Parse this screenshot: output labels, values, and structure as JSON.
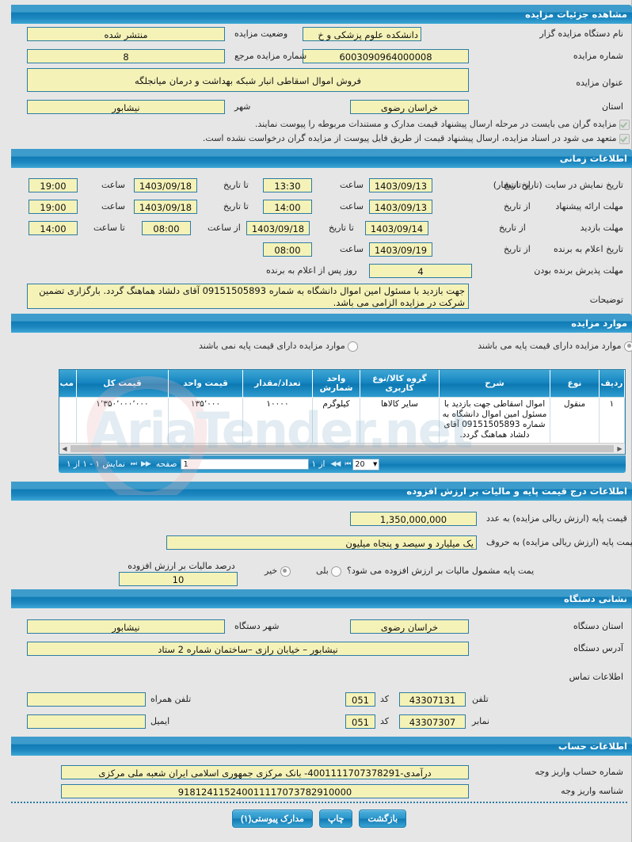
{
  "sections": {
    "details": "مشاهده جزئیات مزایده",
    "timing": "اطلاعات زمانی",
    "items": "موارد مزایده",
    "base_price": "اطلاعات درج قیمت پایه و مالیات بر ارزش افزوده",
    "address": "نشانی دستگاه",
    "account": "اطلاعات حساب"
  },
  "details": {
    "org_label": "نام دستگاه مزایده گزار",
    "org_value": "دانشکده علوم پزشکی و خ",
    "status_label": "وضعیت مزایده",
    "status_value": "منتشر شده",
    "auction_no_label": "شماره مزایده",
    "auction_no_value": "6003090964000008",
    "ref_no_label": "شماره مزایده مرجع",
    "ref_no_value": "8",
    "title_label": "عنوان مزایده",
    "title_value": "فروش اموال اسقاطی انبار شبکه بهداشت و درمان میانجلگه",
    "province_label": "استان",
    "province_value": "خراسان رضوی",
    "city_label": "شهر",
    "city_value": "نیشابور",
    "note1": "مزایده گران می بایست در مرحله ارسال پیشنهاد قیمت مدارک و مستندات مربوطه را پیوست نمایند.",
    "note2": "متعهد می شود در اسناد مزایده، ارسال پیشنهاد قیمت از طریق فایل پیوست از مزایده گران درخواست نشده است."
  },
  "timing": {
    "rows": [
      {
        "label": "تاریخ نمایش در سایت (تاریخ انتشار)",
        "from_label": "از تاریخ",
        "from_value": "1403/09/13",
        "time1_label": "ساعت",
        "time1_value": "13:30",
        "to_label": "تا تاریخ",
        "to_value": "1403/09/18",
        "time2_label": "ساعت",
        "time2_value": "19:00"
      },
      {
        "label": "مهلت ارائه پیشنهاد",
        "from_label": "از تاریخ",
        "from_value": "1403/09/13",
        "time1_label": "ساعت",
        "time1_value": "14:00",
        "to_label": "تا تاریخ",
        "to_value": "1403/09/18",
        "time2_label": "ساعت",
        "time2_value": "19:00"
      },
      {
        "label": "مهلت بازدید",
        "from_label": "از تاریخ",
        "from_value": "1403/09/14",
        "to_label": "تا تاریخ",
        "to_value": "1403/09/18",
        "time1_label": "از ساعت",
        "time1_value": "08:00",
        "time2_label": "تا ساعت",
        "time2_value": "14:00"
      }
    ],
    "winner_label": "تاریخ اعلام به برنده",
    "winner_from_label": "از تاریخ",
    "winner_from_value": "1403/09/19",
    "winner_time_label": "ساعت",
    "winner_time_value": "08:00",
    "accept_label": "مهلت پذیرش برنده بودن",
    "accept_value": "4",
    "accept_suffix": "روز پس از اعلام به برنده",
    "desc_label": "توضیحات",
    "desc_value": "جهت بازدید با مسئول امین اموال دانشگاه به شماره 09151505893 آقای دلشاد هماهنگ گردد.  بارگزاری تضمین شرکت در مزایده الزامی می باشد."
  },
  "items": {
    "radio_with_base": "موارد مزایده دارای قیمت پایه می باشند",
    "radio_without_base": "موارد مزایده دارای قیمت پایه نمی باشند",
    "selected": "with_base",
    "columns": [
      "ردیف",
      "نوع",
      "شرح",
      "گروه کالا/نوع کاربری",
      "واحد شمارش",
      "تعداد/مقدار",
      "قیمت واحد",
      "قیمت کل",
      "مب"
    ],
    "rows": [
      {
        "radif": "۱",
        "noe": "منقول",
        "sharh": "اموال اسقاطی جهت بازدید با مسئول امین اموال دانشگاه به شماره 09151505893 آقای دلشاد هماهنگ گردد.",
        "group": "سایر کالاها",
        "unit": "کیلوگرم",
        "qty": "۱۰۰۰۰",
        "unit_price": "۱۳۵٬۰۰۰",
        "total_price": "۱٬۳۵۰٬۰۰۰٬۰۰۰",
        "guarantee": ""
      }
    ],
    "pager": {
      "showing": "نمایش ۱ - ۱ از ۱",
      "first": "⏮",
      "prev": "◀◀",
      "page_label": "صفحه",
      "page_value": "1",
      "of_label": "از ۱",
      "next": "▶▶",
      "last": "⏭",
      "page_size": "20"
    }
  },
  "base_price": {
    "numeric_label": "قیمت پایه (ارزش ریالی مزایده) به عدد",
    "numeric_value": "1,350,000,000",
    "words_label": "قیمت پایه (ارزش ریالی مزایده) به حروف",
    "words_value": "یک میلیارد و سیصد و پنجاه میلیون",
    "vat_question": "یمت پایه مشمول مالیات بر ارزش افزوده می شود؟",
    "vat_yes": "بلی",
    "vat_no": "خیر",
    "vat_selected": "no",
    "vat_percent_label": "درصد مالیات بر ارزش افزوده",
    "vat_percent_value": "10"
  },
  "address": {
    "province_label": "استان دستگاه",
    "province_value": "خراسان رضوی",
    "city_label": "شهر دستگاه",
    "city_value": "نیشابور",
    "address_label": "آدرس دستگاه",
    "address_value": "نیشابور – خیابان رازی –ساختمان شماره 2 ستاد",
    "contact_title": "اطلاعات تماس",
    "phone_label": "تلفن",
    "phone_value": "43307131",
    "phone_code_label": "کد",
    "phone_code_value": "051",
    "mobile_label": "تلفن همراه",
    "mobile_value": "",
    "fax_label": "نمابر",
    "fax_value": "43307307",
    "fax_code_label": "کد",
    "fax_code_value": "051",
    "email_label": "ایمیل",
    "email_value": ""
  },
  "account": {
    "acct_label": "شماره حساب واریز وجه",
    "acct_value": "درآمدی-4001111707378291- بانک مرکزی جمهوری اسلامی ایران شعبه ملی مرکزی",
    "shenase_label": "شناسه واریز وجه",
    "shenase_value": "918124115240011117073782910000"
  },
  "buttons": {
    "attachments": "مدارک پیوستی(۱)",
    "print": "چاپ",
    "back": "بازگشت"
  },
  "watermark": "AriaTender.net"
}
